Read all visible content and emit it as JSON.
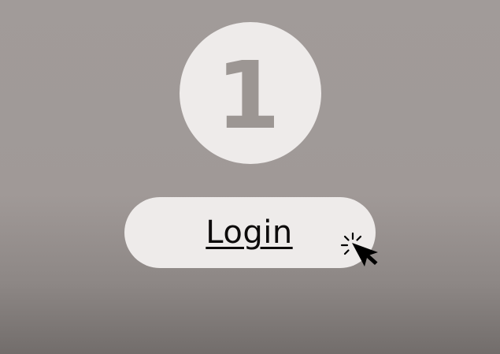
{
  "step": {
    "number": "1",
    "badge_color": "#eeebea",
    "number_color": "#9c9693"
  },
  "login_button": {
    "label": "Login",
    "background": "#eeebea",
    "text_color": "#0d0b0b"
  },
  "cursor": {
    "icon": "click-cursor-icon"
  },
  "background": {
    "color_top": "#a19b99",
    "color_bottom": "#726d6b"
  }
}
